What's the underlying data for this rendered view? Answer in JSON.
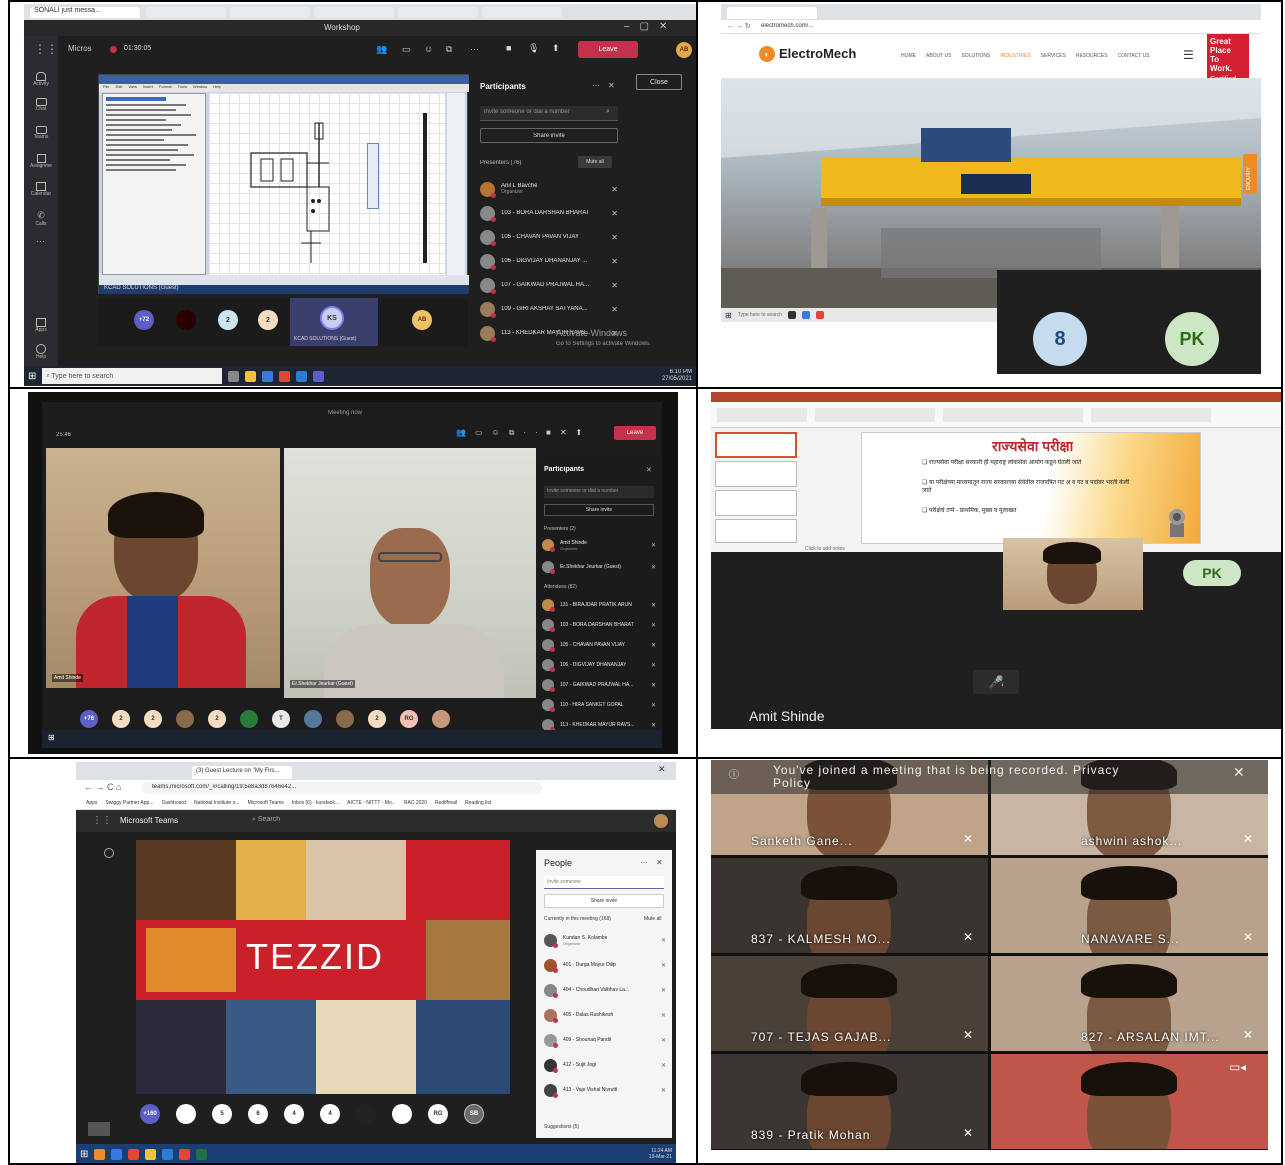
{
  "p1": {
    "chrome_tab": "SONALI just messa...",
    "window_title": "Workshop",
    "app_name": "Micros",
    "timer": "01:30:05",
    "leave_label": "Leave",
    "close_label": "Close",
    "cad_menus": [
      "File",
      "Edit",
      "View",
      "Insert",
      "Format",
      "Tools",
      "Window",
      "Help"
    ],
    "share_caption": "KCAD SOLUTIONS (Guest)",
    "nav": [
      "Activity",
      "Chat",
      "Teams",
      "Assignments",
      "Calendar",
      "Calls",
      "Apps",
      "Help"
    ],
    "participants_title": "Participants",
    "invite_placeholder": "Invite someone or dial a number",
    "share_invite": "Share invite",
    "presenters_label": "Presenters (76)",
    "mute_all": "Mute all",
    "people": [
      {
        "name": "Anil L Bavche",
        "role": "Organizer",
        "color": "#b87333"
      },
      {
        "name": "103 - BORA DARSHAN BHARAT",
        "role": "",
        "color": "#888"
      },
      {
        "name": "105 - CHAVAN PAVAN VIJAY",
        "role": "",
        "color": "#888"
      },
      {
        "name": "106 - DIGVIJAY DHANANJAY ...",
        "role": "",
        "color": "#888"
      },
      {
        "name": "107 - GAIKWAD PRAJWAL HA...",
        "role": "",
        "color": "#888"
      },
      {
        "name": "109 - GIRI AKSHAY SATYANA...",
        "role": "",
        "color": "#9a7b5a"
      },
      {
        "name": "113 - KHEDKAR MAYUR RAVS...",
        "role": "",
        "color": "#9a7b5a"
      }
    ],
    "bottom_avatars": [
      "+72",
      "",
      "2",
      "2",
      "KS",
      "AB"
    ],
    "ks_caption": "KCAD SOLUTIONS (Guest)",
    "activate_1": "Activate Windows",
    "activate_2": "Go to Settings to activate Windows.",
    "search_placeholder": "Type here to search",
    "clock_time": "6:10 PM",
    "clock_date": "27/05/2021"
  },
  "p2": {
    "url": "electromech.com/...",
    "brand": "ElectroMech",
    "nav_items": [
      "HOME",
      "ABOUT US",
      "SOLUTIONS",
      "INDUSTRIES",
      "SERVICES",
      "RESOURCES",
      "CONTACT US"
    ],
    "badge_lines": [
      "Great",
      "Place",
      "To",
      "Work.",
      "Certified"
    ],
    "side_tab": "ENQUIRY",
    "search_placeholder": "Type here to search",
    "tile_a": "8",
    "tile_b": "PK"
  },
  "p3": {
    "window_title": "Meeting now",
    "timer": "25:46",
    "leave_label": "Leave",
    "participants_title": "Participants",
    "invite_placeholder": "Invite someone or dial a number",
    "share_invite": "Share invite",
    "presenters_label": "Presenters (2)",
    "attendees_label": "Attendees (82)",
    "people": [
      {
        "name": "Amit Shinde",
        "role": "Organizer",
        "color": "#c28a4a"
      },
      {
        "name": "Er.Shekhar Jeurkar (Guest)",
        "role": "",
        "color": "#888"
      },
      {
        "name": "131 - BIRAJDAR PRATIK ARUN",
        "role": "",
        "color": "#c28a4a"
      },
      {
        "name": "103 - BORA DARSHAN BHARAT",
        "role": "",
        "color": "#888"
      },
      {
        "name": "105 - CHAVAN PAVAN VIJAY",
        "role": "",
        "color": "#888"
      },
      {
        "name": "106 - DIGVIJAY DHANANJAY",
        "role": "",
        "color": "#888"
      },
      {
        "name": "107 - GAIKWAD PRAJWAL HA...",
        "role": "",
        "color": "#888"
      },
      {
        "name": "110 - HIRA SANKET GOPAL",
        "role": "",
        "color": "#888"
      },
      {
        "name": "113 - KHEDKAR MAYUR RAVS...",
        "role": "",
        "color": "#888"
      }
    ],
    "label_left": "Amit Shinde",
    "label_right": "Er.Shekhar Jeurkar (Guest)",
    "bottom_avatars": [
      "+76",
      "2",
      "2",
      "",
      "2",
      "",
      "T",
      "",
      "",
      "2",
      "RG",
      ""
    ]
  },
  "p4": {
    "slide_title": "राज्यसेवा परीक्षा",
    "bullets": [
      "राज्यसेवा परीक्षा सरकारी ही महाराष्ट्र लोकसेवा आयोग कडून घेतली जाते",
      "या परीक्षेच्या माध्यमातून राज्य सरकारच्या सेवेतील राजपत्रित गट अ व गट ब पदांवर भरती केली जाते",
      "परीक्षेचे टप्पे - प्राथमिक, मुख्य व मुलाखत"
    ],
    "notes_placeholder": "Click to add notes",
    "avatar": "PK",
    "speaker_name": "Amit Shinde"
  },
  "p5": {
    "tab_label": "(3) Guest Lecture on \"My Firs...",
    "url": "teams.microsoft.com/_#/calling/19:5e8a3d87646e42...",
    "bookmarks": [
      "Apps",
      "Swiggy Partner App...",
      "Dashboard",
      "National Institute o...",
      "Microsoft Teams",
      "Inbox (6) - kundank...",
      "AICTE - NITTT - Mo...",
      "RAC 2020",
      "Rediffmail",
      "Reading list"
    ],
    "app_name": "Microsoft Teams",
    "search_label": "Search",
    "brand_word": "TEZZID",
    "people_title": "People",
    "invite_placeholder": "Invite someone",
    "share_invite": "Share invite",
    "in_meeting_label": "Currently in this meeting (168)",
    "mute_all": "Mute all",
    "people": [
      {
        "name": "Kundan S. Kolambe",
        "role": "Organizer",
        "color": "#555"
      },
      {
        "name": "401 - Durga Mayur Dilip",
        "role": "",
        "color": "#a0522d"
      },
      {
        "name": "404 - Choudhari Vaibhav La...",
        "role": "",
        "color": "#888"
      },
      {
        "name": "405 - Dalas Rushikesh",
        "role": "",
        "color": "#b07060"
      },
      {
        "name": "409 - Shounaq Pandit",
        "role": "",
        "color": "#999"
      },
      {
        "name": "412 - Sujit Jogi",
        "role": "",
        "color": "#333"
      },
      {
        "name": "413 - Vaje Vishal Nivrutti",
        "role": "",
        "color": "#444"
      }
    ],
    "suggestions_label": "Suggestions (5)",
    "bottom_avatars": [
      "+160",
      "",
      "5",
      "6",
      "4",
      "4",
      "",
      "",
      "RG",
      "SB"
    ],
    "clock_time": "11:24 AM",
    "clock_date": "19-Mar-21"
  },
  "p6": {
    "banner": "You've joined a meeting that is being recorded. Privacy Policy",
    "tiles": [
      "Sanketh Gane...",
      "ashwini ashok...",
      "837 - KALMESH MO...",
      "NANAVARE S...",
      "707 - TEJAS GAJAB...",
      "827 - ARSALAN IMT...",
      "839 - Pratik Mohan",
      ""
    ]
  }
}
